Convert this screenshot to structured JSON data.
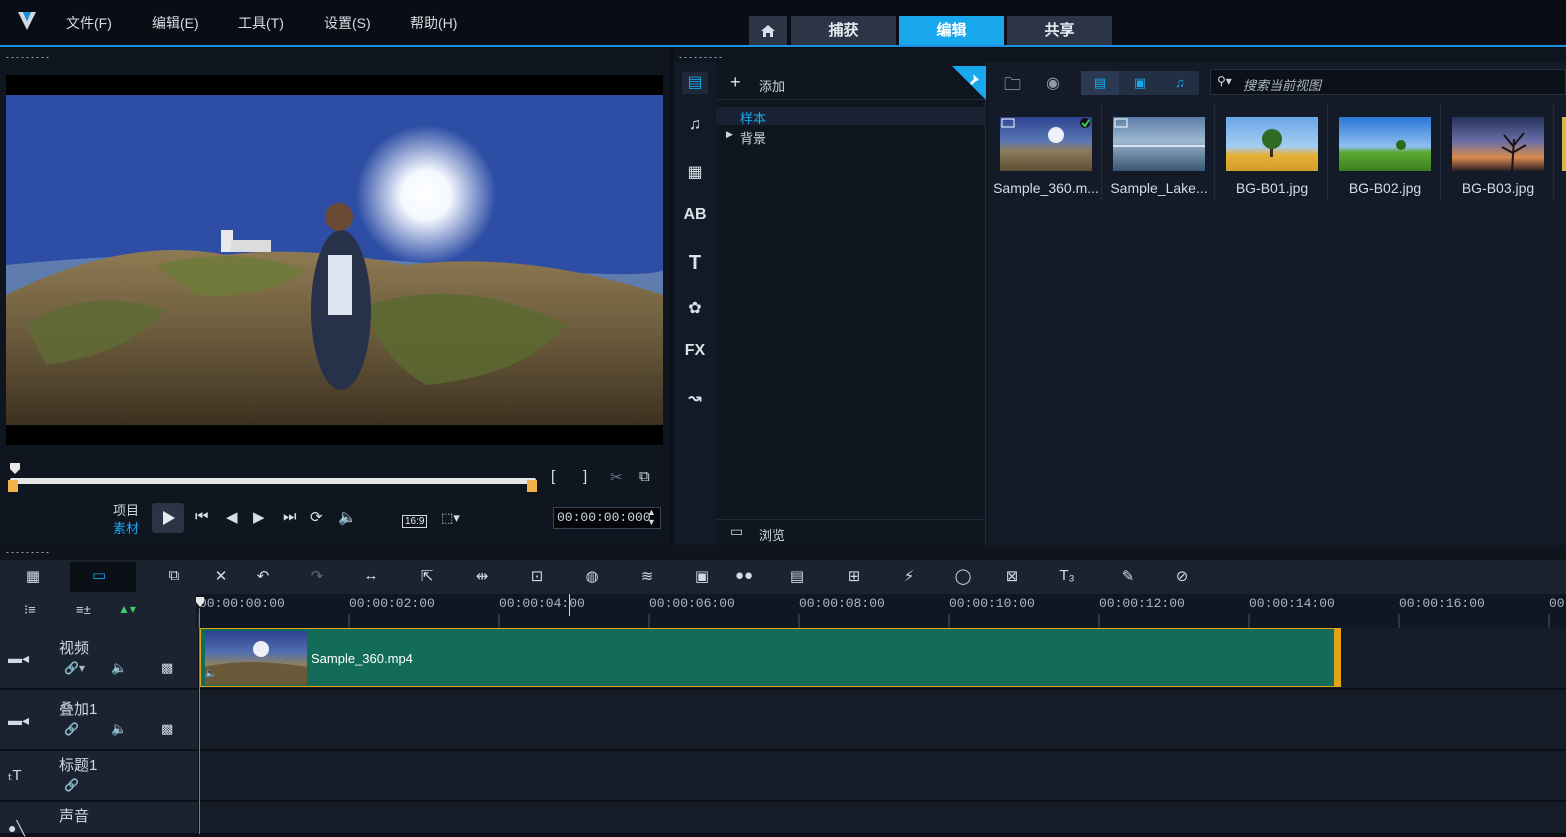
{
  "menu": {
    "file": "文件(F)",
    "edit": "编辑(E)",
    "tools": "工具(T)",
    "settings": "设置(S)",
    "help": "帮助(H)"
  },
  "mode_tabs": {
    "capture": "捕获",
    "edit": "编辑",
    "share": "共享"
  },
  "player": {
    "project_label": "项目",
    "clip_label": "素材",
    "timecode": "00:00:00:000",
    "aspect_ratio": "16:9"
  },
  "library": {
    "add_label": "添加",
    "tree_sample": "样本",
    "tree_background": "背景",
    "browse_label": "浏览",
    "search_placeholder": "搜索当前视图"
  },
  "media_items": [
    {
      "label": "Sample_360.m..."
    },
    {
      "label": "Sample_Lake..."
    },
    {
      "label": "BG-B01.jpg"
    },
    {
      "label": "BG-B02.jpg"
    },
    {
      "label": "BG-B03.jpg"
    }
  ],
  "ruler_ticks": [
    "00:00:00:00",
    "00:00:02:00",
    "00:00:04:00",
    "00:00:06:00",
    "00:00:08:00",
    "00:00:10:00",
    "00:00:12:00",
    "00:00:14:00",
    "00:00:16:00",
    "00"
  ],
  "tracks": [
    {
      "name": "视频"
    },
    {
      "name": "叠加1"
    },
    {
      "name": "标题1"
    },
    {
      "name": "声音"
    }
  ],
  "clip": {
    "label": "Sample_360.mp4"
  },
  "colors": {
    "accent": "#19a8ee",
    "clip": "#126c58",
    "clip_border": "#e2a417"
  }
}
